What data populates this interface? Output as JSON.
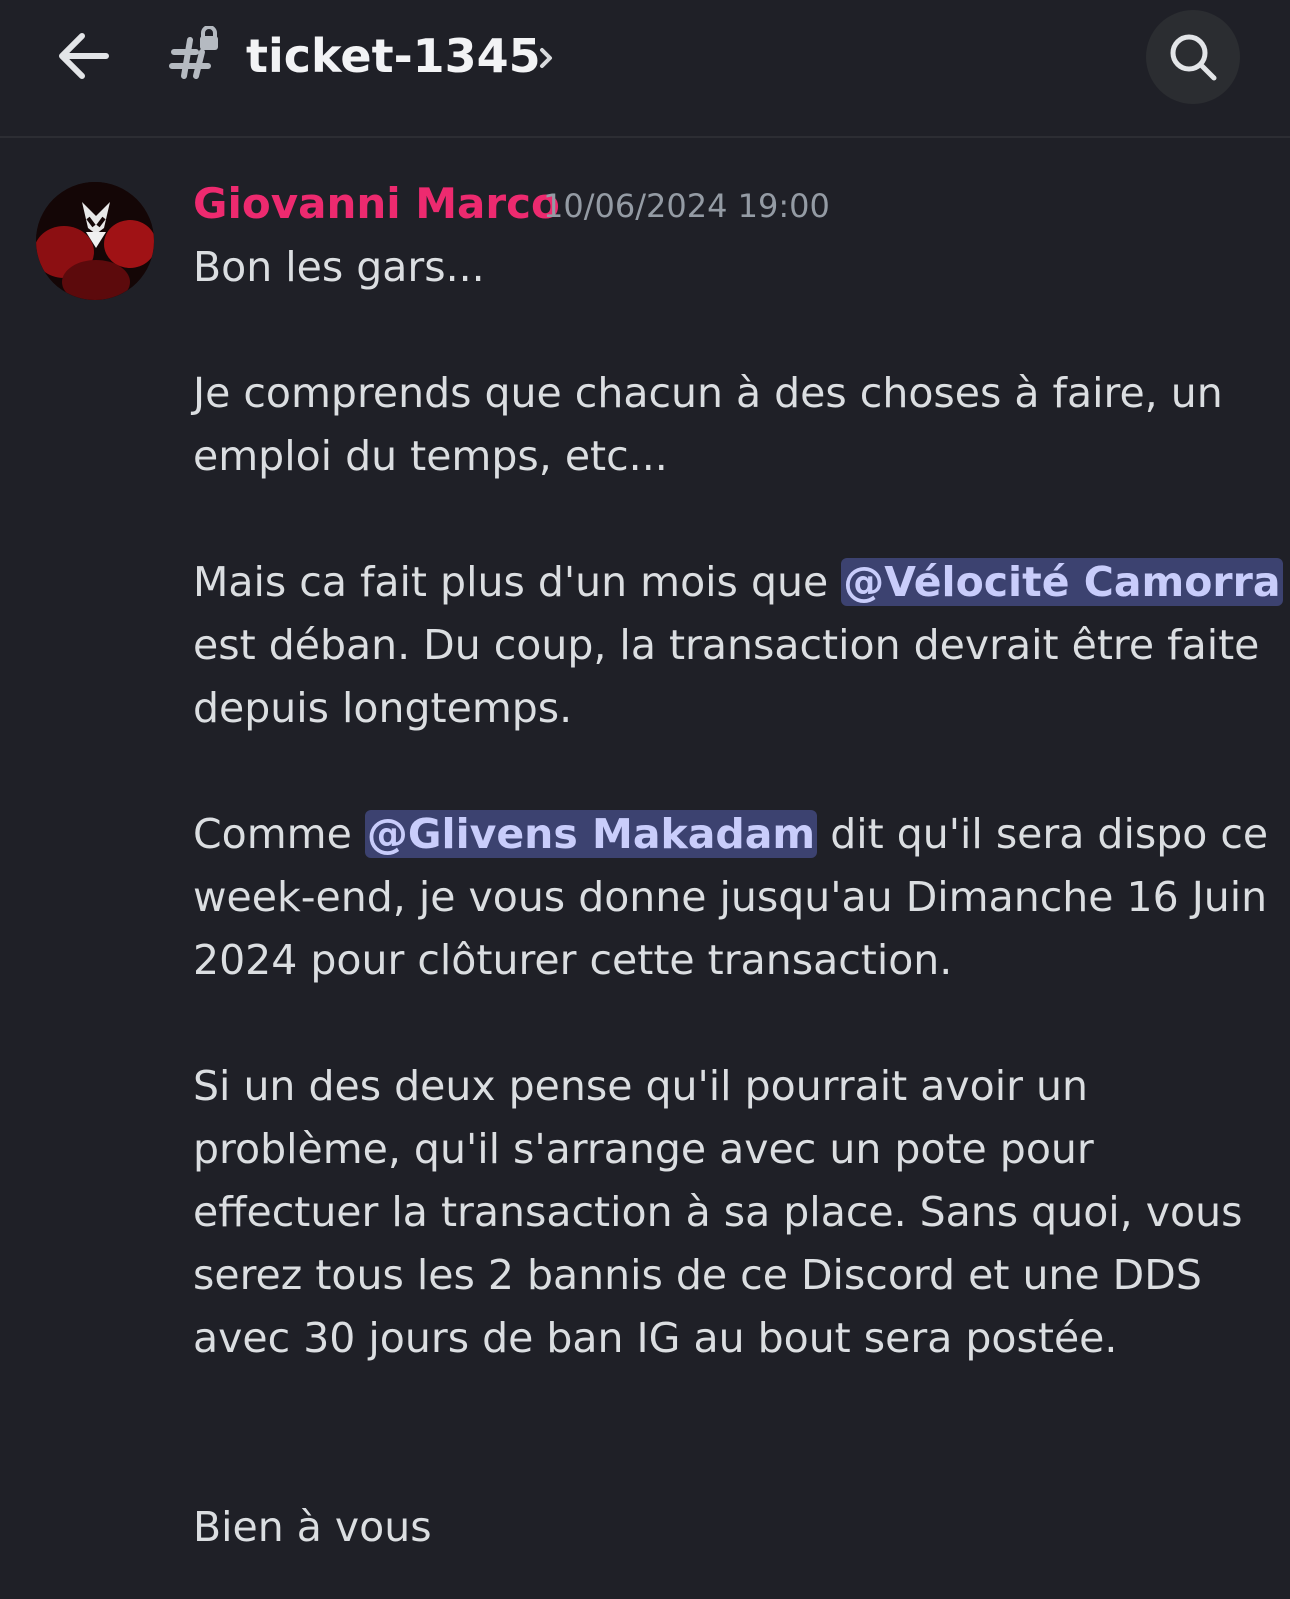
{
  "header": {
    "channel_name": "ticket-1345"
  },
  "message": {
    "author": "Giovanni Marco",
    "timestamp": "10/06/2024 19:00",
    "author_color": "#ed2a6f",
    "line1": "Bon les gars...",
    "line2": "Je comprends que chacun à des choses à faire, un",
    "line3": "emploi du temps, etc...",
    "line4_pre": "Mais ca fait plus d'un mois que ",
    "mention1": "@Vélocité Camorra",
    "line5": "est déban. Du coup, la transaction devrait être faite",
    "line6": "depuis longtemps.",
    "line7_pre": "Comme ",
    "mention2": "@Glivens Makadam",
    "line7_post": " dit qu'il sera dispo ce",
    "line8": "week-end, je vous donne jusqu'au Dimanche 16 Juin",
    "line9": "2024 pour clôturer cette transaction.",
    "line10": "Si un des deux pense qu'il pourrait avoir un",
    "line11": "problème, qu'il s'arrange avec un pote pour",
    "line12": "effectuer la transaction à sa place. Sans quoi, vous",
    "line13": "serez tous les 2 bannis de ce Discord et une DDS",
    "line14": "avec 30 jours de ban IG au bout sera postée.",
    "line15": "Bien à vous"
  },
  "colors": {
    "background": "#1f2027",
    "mention_bg": "#3c4270",
    "mention_fg": "#c9cdfb"
  }
}
